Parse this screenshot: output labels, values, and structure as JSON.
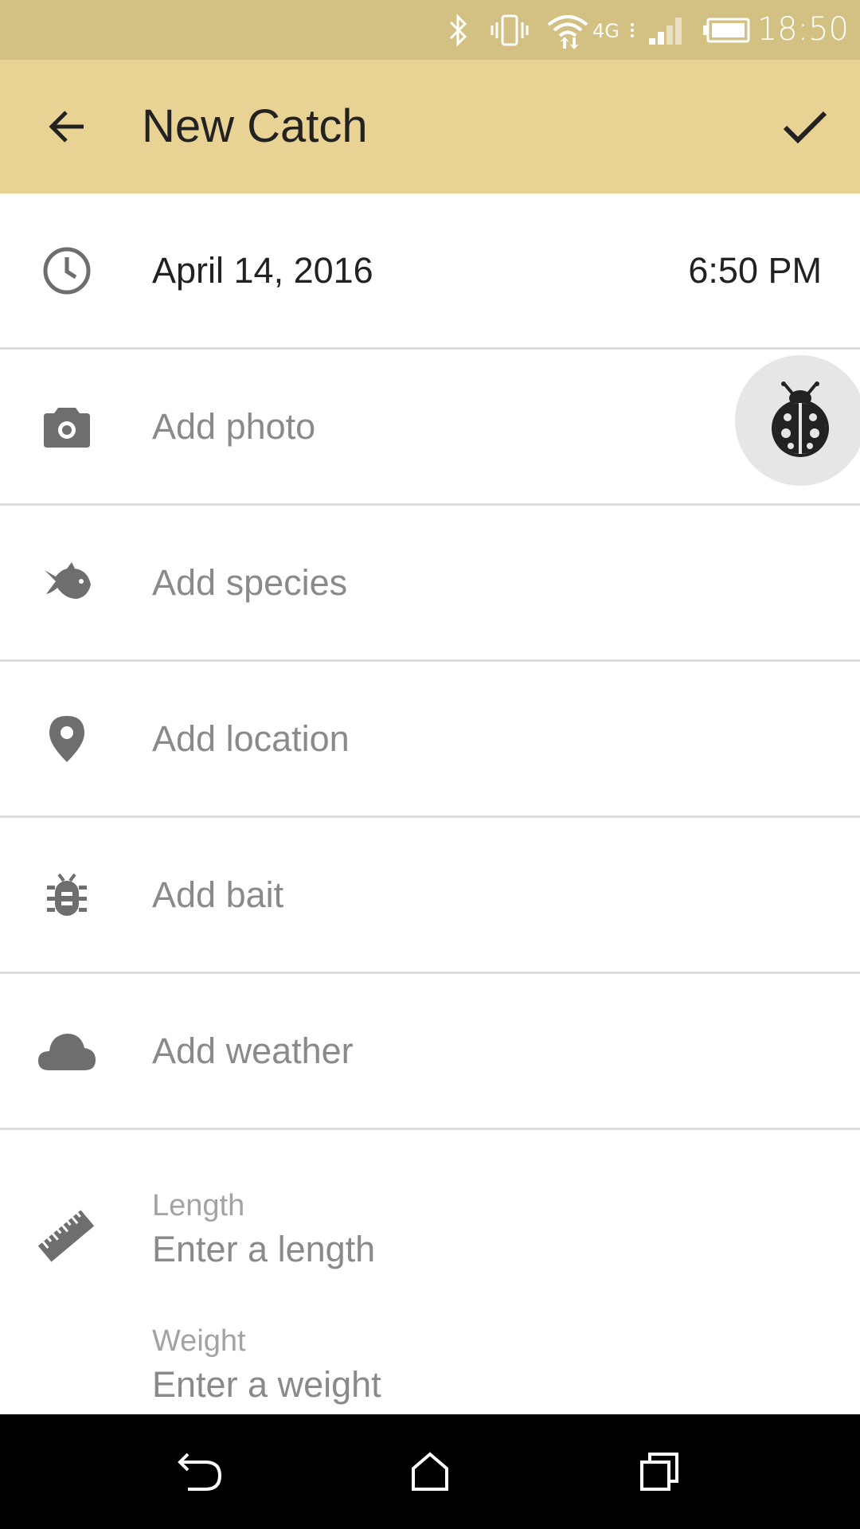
{
  "status_bar": {
    "time": "18:50",
    "icons": [
      "bluetooth-icon",
      "vibrate-icon",
      "wifi-icon",
      "4g-icon",
      "signal-icon",
      "battery-icon"
    ]
  },
  "app_bar": {
    "title": "New Catch",
    "back_icon": "arrow-back-icon",
    "done_icon": "check-icon",
    "background": "#e9d394"
  },
  "rows": {
    "datetime": {
      "icon": "clock-icon",
      "date": "April 14, 2016",
      "time": "6:50 PM"
    },
    "photo": {
      "icon": "camera-icon",
      "label": "Add photo"
    },
    "species": {
      "icon": "fish-icon",
      "label": "Add species"
    },
    "location": {
      "icon": "location-pin-icon",
      "label": "Add location"
    },
    "bait": {
      "icon": "bug-icon",
      "label": "Add bait"
    },
    "weather": {
      "icon": "cloud-icon",
      "label": "Add weather"
    }
  },
  "fab": {
    "icon": "ladybug-icon"
  },
  "measurements": {
    "icon": "ruler-icon",
    "length": {
      "label": "Length",
      "placeholder": "Enter a length",
      "value": ""
    },
    "weight": {
      "label": "Weight",
      "placeholder": "Enter a weight",
      "value": ""
    }
  },
  "nav_bar": {
    "icons": [
      "back-nav-icon",
      "home-icon",
      "recents-icon"
    ]
  }
}
